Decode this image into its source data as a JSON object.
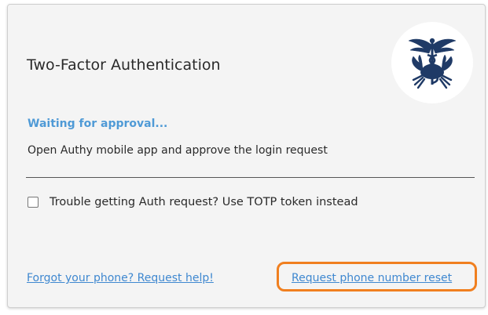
{
  "dialog": {
    "title": "Two-Factor Authentication",
    "logo_icon": "caduceus-crab-emblem-icon",
    "status": "Waiting for approval...",
    "instruction": "Open Authy mobile app and approve the login request",
    "totp_checkbox": {
      "label": "Trouble getting Auth request? Use TOTP token instead",
      "checked": false
    },
    "links": {
      "forgot_phone": "Forgot your phone? Request help!",
      "reset_phone": "Request phone number reset"
    }
  },
  "colors": {
    "status_blue": "#4f9ad6",
    "link_blue": "#3f88d0",
    "highlight_orange": "#f07f1f",
    "logo_navy": "#1f3a66"
  }
}
